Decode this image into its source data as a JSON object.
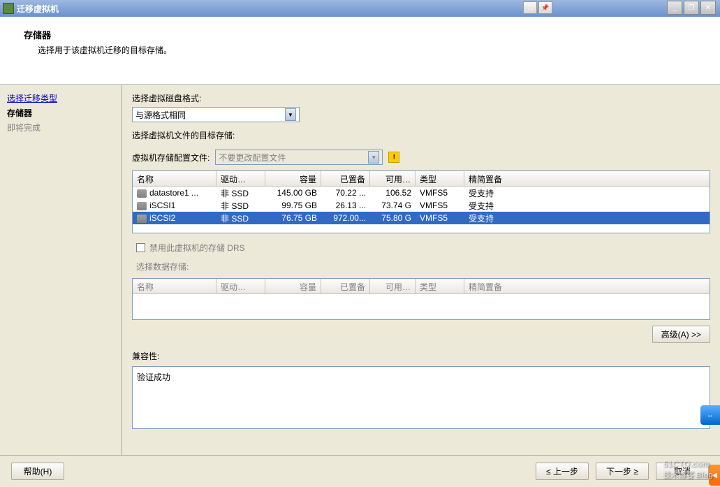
{
  "titlebar": {
    "title": "迁移虚拟机"
  },
  "header": {
    "title": "存储器",
    "subtitle": "选择用于该虚拟机迁移的目标存储。"
  },
  "sidebar": {
    "items": [
      {
        "label": "选择迁移类型",
        "type": "link"
      },
      {
        "label": "存储器",
        "type": "bold"
      },
      {
        "label": "即将完成",
        "type": "disabled"
      }
    ]
  },
  "main": {
    "disk_format_label": "选择虚拟磁盘格式:",
    "disk_format_value": "与源格式相同",
    "target_storage_label": "选择虚拟机文件的目标存储:",
    "profile_label": "虚拟机存储配置文件:",
    "profile_value": "不要更改配置文件",
    "columns": {
      "name": "名称",
      "drive": "驱动…",
      "capacity": "容量",
      "provisioned": "已置备",
      "available": "可用…",
      "type": "类型",
      "thin": "精简置备"
    },
    "datastores": [
      {
        "name": "datastore1 ...",
        "drive": "非 SSD",
        "capacity": "145.00 GB",
        "provisioned": "70.22 ...",
        "available": "106.52",
        "type": "VMFS5",
        "thin": "受支持"
      },
      {
        "name": "iSCSI1",
        "drive": "非 SSD",
        "capacity": "99.75 GB",
        "provisioned": "26.13 ...",
        "available": "73.74 G",
        "type": "VMFS5",
        "thin": "受支持"
      },
      {
        "name": "iSCSI2",
        "drive": "非 SSD",
        "capacity": "76.75 GB",
        "provisioned": "972.00...",
        "available": "75.80 G",
        "type": "VMFS5",
        "thin": "受支持"
      }
    ],
    "drs_checkbox": "禁用此虚拟机的存储 DRS",
    "second_table_label": "选择数据存储:",
    "advanced_btn": "高级(A) >>",
    "compat_label": "兼容性:",
    "compat_text": "验证成功"
  },
  "buttons": {
    "help": "帮助(H)",
    "back": "≤ 上一步",
    "next": "下一步 ≥",
    "cancel": "取消"
  },
  "watermark": {
    "main": "51CTO.com",
    "sub": "技术博客  Blog"
  }
}
